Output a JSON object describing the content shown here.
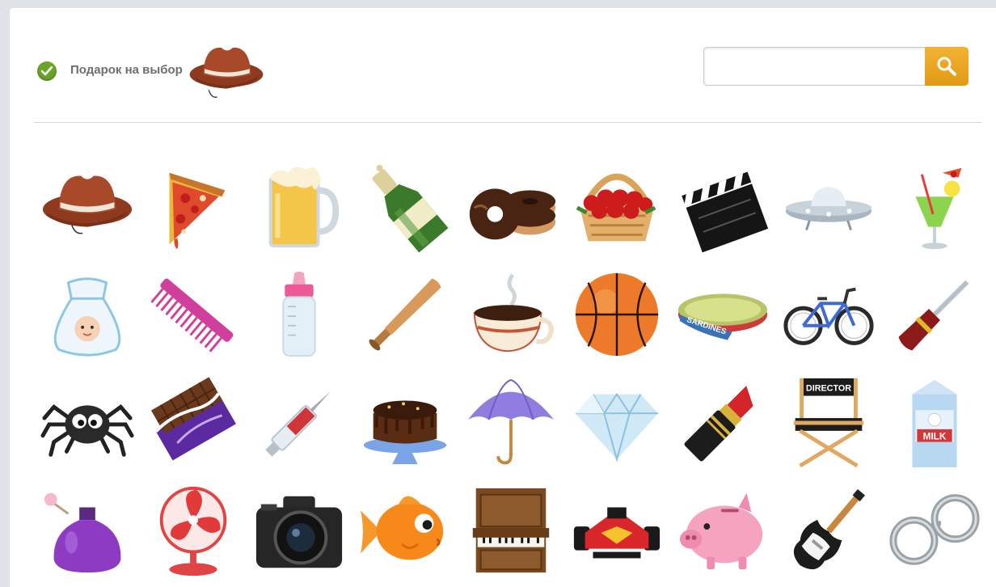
{
  "header": {
    "label": "Подарок на выбор",
    "selected_gift_icon": "cowboy-hat-icon",
    "check_color": "#6aa428"
  },
  "search": {
    "value": "",
    "placeholder": "",
    "button_color": "#e9a521",
    "button_icon": "magnifier-icon"
  },
  "gifts": [
    "cowboy-hat",
    "pizza-slice",
    "beer-mug",
    "champagne-bottle",
    "donuts",
    "flower-basket",
    "clapperboard",
    "ufo",
    "cocktail",
    "baby-bag",
    "comb",
    "baby-bottle",
    "baseball-bat",
    "coffee-cup",
    "basketball",
    "sardines-can",
    "bicycle",
    "screwdriver",
    "spider",
    "chocolate-bar",
    "syringe",
    "chocolate-cake",
    "umbrella",
    "diamond",
    "lipstick",
    "director-chair",
    "milk-carton",
    "perfume-bottle",
    "desk-fan",
    "camera",
    "goldfish",
    "piano",
    "race-car",
    "piggy-bank",
    "electric-guitar",
    "handcuffs"
  ],
  "icon_text": {
    "sardines": "SARDINES",
    "director": "DIRECTOR",
    "milk": "MILK"
  }
}
